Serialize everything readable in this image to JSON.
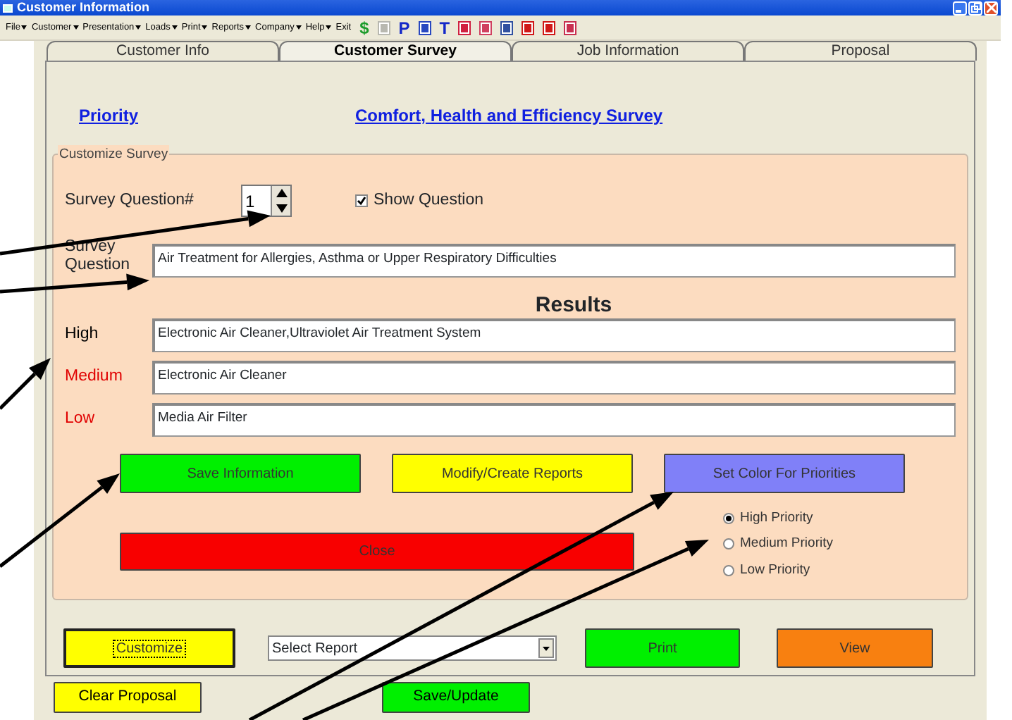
{
  "window": {
    "title": "Customer Information"
  },
  "menu": [
    {
      "label": "File",
      "dropdown": true
    },
    {
      "label": "Customer",
      "dropdown": true
    },
    {
      "label": "Presentation",
      "dropdown": true
    },
    {
      "label": "Loads",
      "dropdown": true
    },
    {
      "label": "Print",
      "dropdown": true
    },
    {
      "label": "Reports",
      "dropdown": true
    },
    {
      "label": "Company",
      "dropdown": true
    },
    {
      "label": "Help",
      "dropdown": true
    },
    {
      "label": "Exit",
      "dropdown": false
    }
  ],
  "toolbar": [
    {
      "kind": "glyph",
      "glyph": "$",
      "color": "#1c9c2c"
    },
    {
      "kind": "doc",
      "color": "#b8b8b0"
    },
    {
      "kind": "glyph",
      "glyph": "P",
      "color": "#1428c8"
    },
    {
      "kind": "doc",
      "color": "#2848c0"
    },
    {
      "kind": "glyph",
      "glyph": "T",
      "color": "#1428c8"
    },
    {
      "kind": "doc",
      "color": "#d02040"
    },
    {
      "kind": "doc",
      "color": "#d04060"
    },
    {
      "kind": "doc",
      "color": "#3050a0"
    },
    {
      "kind": "doc",
      "color": "#d01818"
    },
    {
      "kind": "doc",
      "color": "#d01818"
    },
    {
      "kind": "doc",
      "color": "#c83050"
    }
  ],
  "tabs": [
    {
      "label": "Customer Info",
      "selected": false
    },
    {
      "label": "Customer Survey",
      "selected": true
    },
    {
      "label": "Job Information",
      "selected": false
    },
    {
      "label": "Proposal",
      "selected": false
    }
  ],
  "header": {
    "priority_link": "Priority",
    "survey_link": "Comfort, Health and Efficiency Survey"
  },
  "customize": {
    "legend": "Customize Survey",
    "question_number_label": "Survey Question#",
    "question_number": "1",
    "show_question": {
      "label": "Show Question",
      "checked": true
    },
    "question_label": "Survey Question",
    "question": "Air Treatment for Allergies, Asthma or Upper Respiratory Difficulties"
  },
  "results": {
    "title": "Results",
    "rows": [
      {
        "label": "High",
        "color": "#000000",
        "value": "Electronic Air Cleaner,Ultraviolet Air Treatment System"
      },
      {
        "label": "Medium",
        "color": "#e00000",
        "value": "Electronic Air Cleaner"
      },
      {
        "label": "Low",
        "color": "#e00000",
        "value": "Media Air Filter"
      }
    ]
  },
  "action_buttons": [
    {
      "label": "Save Information",
      "color": "#00f000"
    },
    {
      "label": "Modify/Create Reports",
      "color": "#ffff00"
    },
    {
      "label": "Set Color For Priorities",
      "color": "#8080f8"
    }
  ],
  "close_button": {
    "label": "Close",
    "color": "#f80000"
  },
  "priority_options": [
    {
      "label": "High Priority",
      "selected": true
    },
    {
      "label": "Medium Priority",
      "selected": false
    },
    {
      "label": "Low Priority",
      "selected": false
    }
  ],
  "bottom_bar": {
    "customize": {
      "label": "Customize",
      "color": "#ffff00",
      "focused": true
    },
    "report_select": {
      "value": "Select Report"
    },
    "print": {
      "label": "Print",
      "color": "#00f000"
    },
    "view": {
      "label": "View",
      "color": "#f88010"
    }
  },
  "footer_buttons": [
    {
      "label": "Clear Proposal",
      "color": "#ffff00"
    },
    {
      "label": "Save/Update",
      "color": "#00f000"
    }
  ]
}
